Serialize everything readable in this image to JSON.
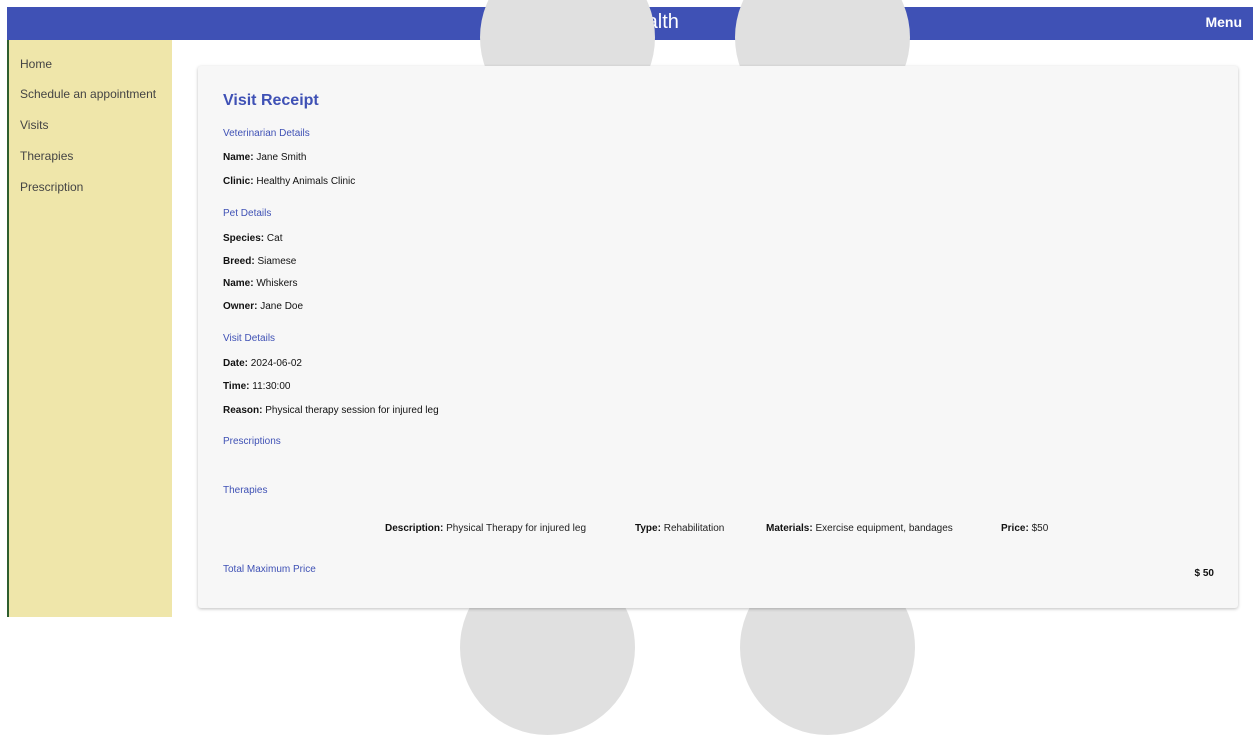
{
  "app": {
    "title": "PetsHealth",
    "menu_label": "Menu"
  },
  "sidebar": {
    "items": [
      {
        "label": "Home"
      },
      {
        "label": "Schedule an appointment"
      },
      {
        "label": "Visits"
      },
      {
        "label": "Therapies"
      },
      {
        "label": "Prescription"
      }
    ]
  },
  "receipt": {
    "heading": "Visit Receipt",
    "vet_section": "Veterinarian Details",
    "vet": {
      "name_label": "Name:",
      "name": " Jane Smith",
      "clinic_label": "Clinic:",
      "clinic": " Healthy Animals Clinic"
    },
    "pet_section": "Pet Details",
    "pet": {
      "species_label": "Species:",
      "species": " Cat",
      "breed_label": "Breed:",
      "breed": " Siamese",
      "name_label": "Name:",
      "name": " Whiskers",
      "owner_label": "Owner:",
      "owner": " Jane Doe"
    },
    "visit_section": "Visit Details",
    "visit": {
      "date_label": "Date:",
      "date": " 2024-06-02",
      "time_label": "Time:",
      "time": " 11:30:00",
      "reason_label": "Reason:",
      "reason": " Physical therapy session for injured leg"
    },
    "prescriptions_section": "Prescriptions",
    "therapies_section": "Therapies",
    "therapy": {
      "description_label": "Description:",
      "description": " Physical Therapy for injured leg",
      "type_label": "Type:",
      "type": " Rehabilitation",
      "materials_label": "Materials:",
      "materials": " Exercise equipment, bandages",
      "price_label": "Price:",
      "price": " $50"
    },
    "total_label": "Total Maximum Price",
    "total_value": "$ 50"
  },
  "colors": {
    "header": "#3f51b5",
    "sidebar": "#efe6aa",
    "accent_text": "#3f51b5"
  }
}
